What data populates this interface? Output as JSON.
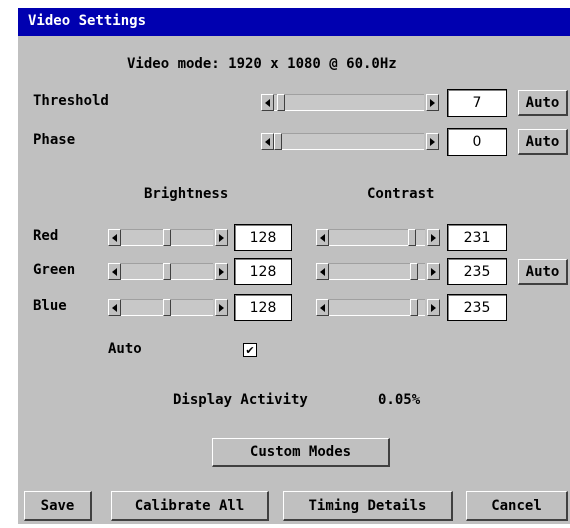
{
  "window": {
    "title": "Video Settings"
  },
  "video_mode": "Video mode: 1920 x 1080 @ 60.0Hz",
  "threshold": {
    "label": "Threshold",
    "value": "7",
    "auto_label": "Auto",
    "level": 0.02
  },
  "phase": {
    "label": "Phase",
    "value": "0",
    "auto_label": "Auto",
    "level": 0.0
  },
  "headers": {
    "brightness": "Brightness",
    "contrast": "Contrast"
  },
  "colors": {
    "red": {
      "label": "Red",
      "brightness": "128",
      "contrast": "231",
      "b_level": 0.5,
      "c_level": 0.9
    },
    "green": {
      "label": "Green",
      "brightness": "128",
      "contrast": "235",
      "b_level": 0.5,
      "c_level": 0.92,
      "auto_label": "Auto"
    },
    "blue": {
      "label": "Blue",
      "brightness": "128",
      "contrast": "235",
      "b_level": 0.5,
      "c_level": 0.92
    }
  },
  "auto_checkbox": {
    "label": "Auto",
    "checked": true,
    "mark": "✔"
  },
  "display_activity": {
    "label": "Display Activity",
    "value": "0.05%"
  },
  "buttons": {
    "custom_modes": "Custom Modes",
    "save": "Save",
    "calibrate_all": "Calibrate All",
    "timing_details": "Timing Details",
    "cancel": "Cancel"
  }
}
